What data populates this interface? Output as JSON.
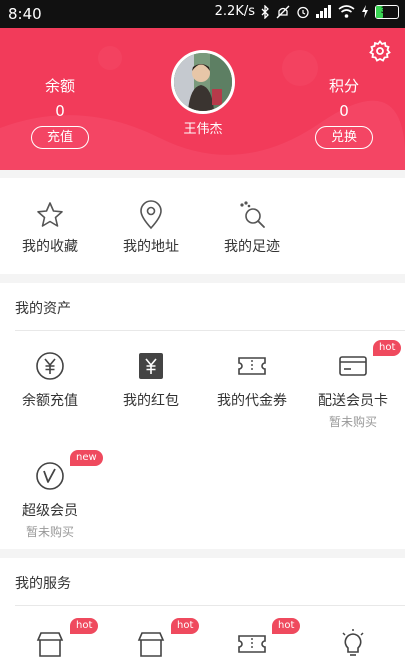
{
  "status_bar": {
    "time": "8:40",
    "speed": "2.2K/s",
    "battery": "31",
    "battery_level": 0.31
  },
  "header": {
    "username": "王伟杰",
    "balance": {
      "label": "余额",
      "value": "0",
      "button": "充值"
    },
    "points": {
      "label": "积分",
      "value": "0",
      "button": "兑换"
    },
    "settings_icon": "gear-icon",
    "background_color": "#f23b5a"
  },
  "quick_links": [
    {
      "label": "我的收藏",
      "icon": "star-icon"
    },
    {
      "label": "我的地址",
      "icon": "location-pin-icon"
    },
    {
      "label": "我的足迹",
      "icon": "footprint-icon"
    }
  ],
  "assets": {
    "title": "我的资产",
    "items": [
      {
        "label": "余额充值",
        "icon": "yuan-circle-icon"
      },
      {
        "label": "我的红包",
        "icon": "red-packet-icon"
      },
      {
        "label": "我的代金券",
        "icon": "coupon-icon"
      },
      {
        "label": "配送会员卡",
        "icon": "card-icon",
        "badge": "hot",
        "sub": "暂未购买"
      },
      {
        "label": "超级会员",
        "icon": "vip-icon",
        "badge": "new",
        "sub": "暂未购买"
      }
    ]
  },
  "services": {
    "title": "我的服务",
    "items": [
      {
        "icon": "store-icon",
        "badge": "hot"
      },
      {
        "icon": "store-icon",
        "badge": "hot"
      },
      {
        "icon": "coupon-icon",
        "badge": "hot"
      },
      {
        "icon": "lightbulb-icon"
      }
    ]
  },
  "accent_color": "#ef4a5e"
}
